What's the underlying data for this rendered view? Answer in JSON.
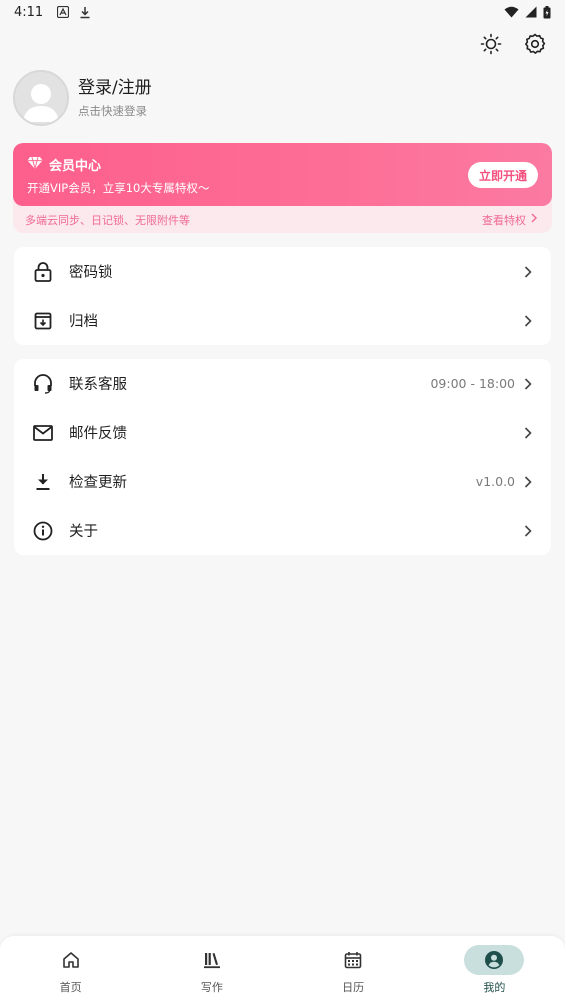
{
  "status": {
    "time": "4:11"
  },
  "profile": {
    "name": "登录/注册",
    "sub": "点击快速登录"
  },
  "vip": {
    "title": "会员中心",
    "subtitle": "开通VIP会员，立享10大专属特权～",
    "button": "立即开通",
    "features": "多端云同步、日记锁、无限附件等",
    "more": "查看特权"
  },
  "group1": [
    {
      "label": "密码锁",
      "icon": "lock-icon"
    },
    {
      "label": "归档",
      "icon": "archive-icon"
    }
  ],
  "group2": [
    {
      "label": "联系客服",
      "value": "09:00 - 18:00",
      "icon": "headset-icon"
    },
    {
      "label": "邮件反馈",
      "value": "",
      "icon": "mail-icon"
    },
    {
      "label": "检查更新",
      "value": "v1.0.0",
      "icon": "download-icon"
    },
    {
      "label": "关于",
      "value": "",
      "icon": "info-icon"
    }
  ],
  "nav": [
    {
      "label": "首页",
      "icon": "home-icon"
    },
    {
      "label": "写作",
      "icon": "books-icon"
    },
    {
      "label": "日历",
      "icon": "calendar-icon"
    },
    {
      "label": "我的",
      "icon": "account-icon",
      "active": true
    }
  ],
  "colors": {
    "vip_gradient_start": "#fd5f8c",
    "vip_gradient_end": "#fb7aa2",
    "vip_text": "#f06991",
    "nav_active_bg": "#c9dfdd"
  }
}
